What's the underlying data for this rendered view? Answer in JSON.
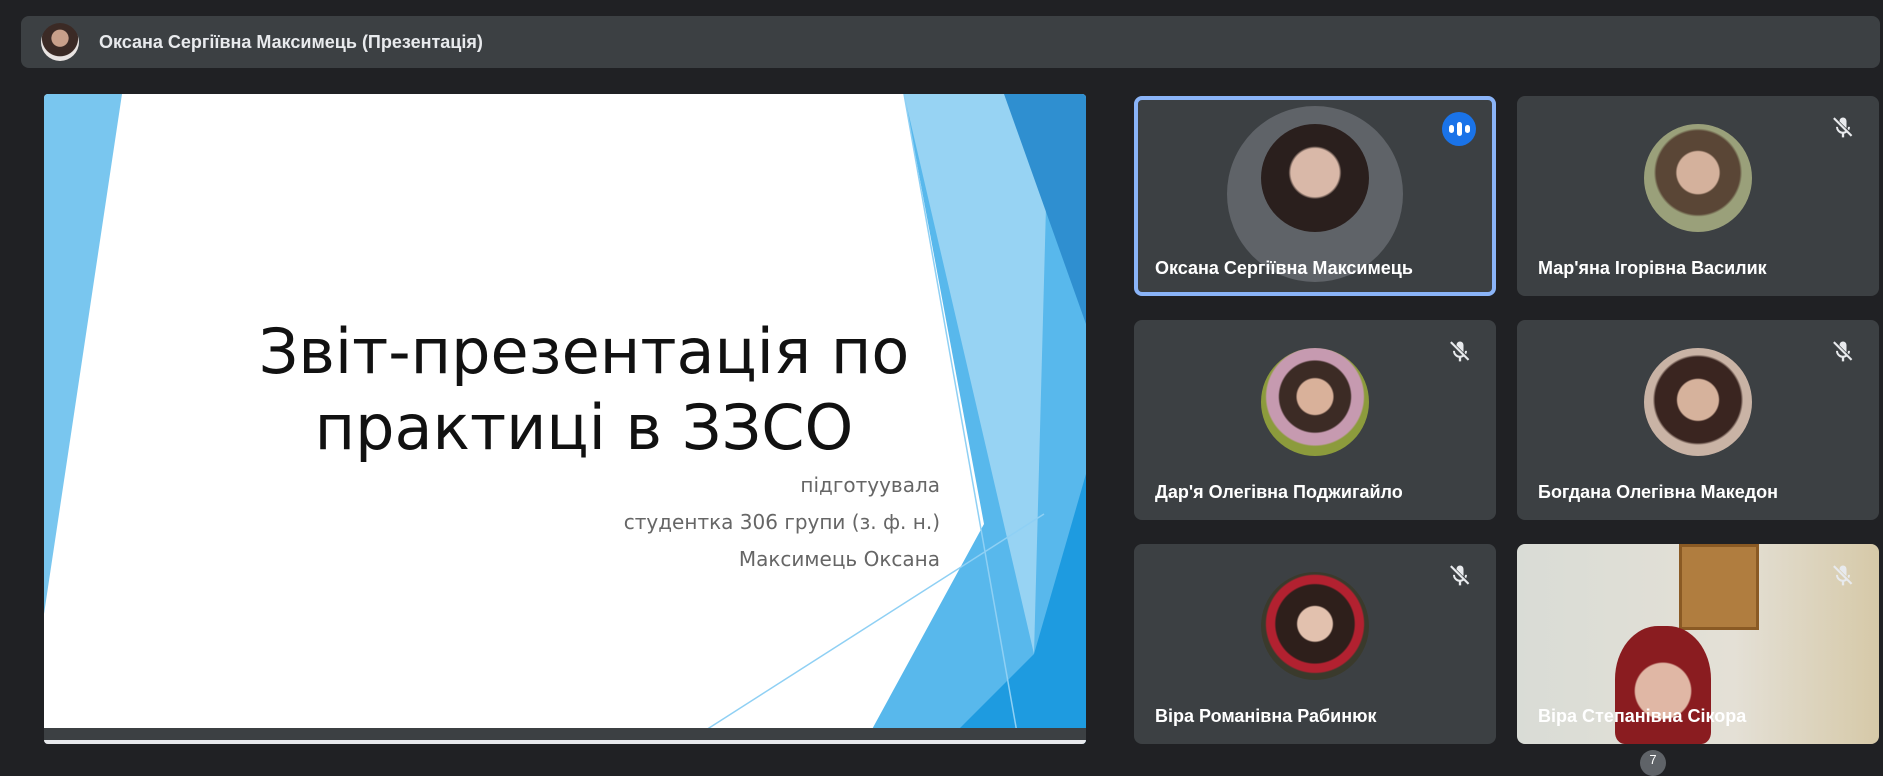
{
  "header": {
    "title": "Оксана Сергіївна Максимець (Презентація)"
  },
  "slide": {
    "title_line1": "Звіт-презентація по",
    "title_line2": "практиці в ЗЗСО",
    "sub1": "підготуувала",
    "sub2": "студентка 306 групи (з. ф. н.)",
    "sub3": "Максимець Оксана"
  },
  "participants": [
    {
      "name": "Оксана Сергіївна Максимець",
      "speaking": true
    },
    {
      "name": "Мар'яна Ігорівна Василик",
      "muted": true
    },
    {
      "name": "Дар'я Олегівна Поджигайло",
      "muted": true
    },
    {
      "name": "Богдана Олегівна Македон",
      "muted": true
    },
    {
      "name": "Віра Романівна Рабинюк",
      "muted": true
    },
    {
      "name": "Віра Степанівна Сікора",
      "muted": true
    }
  ],
  "badge": "7",
  "colors": {
    "background": "#202124",
    "tile": "#3c4043",
    "active_outline": "#8ab4f8",
    "speaking": "#1a73e8"
  }
}
